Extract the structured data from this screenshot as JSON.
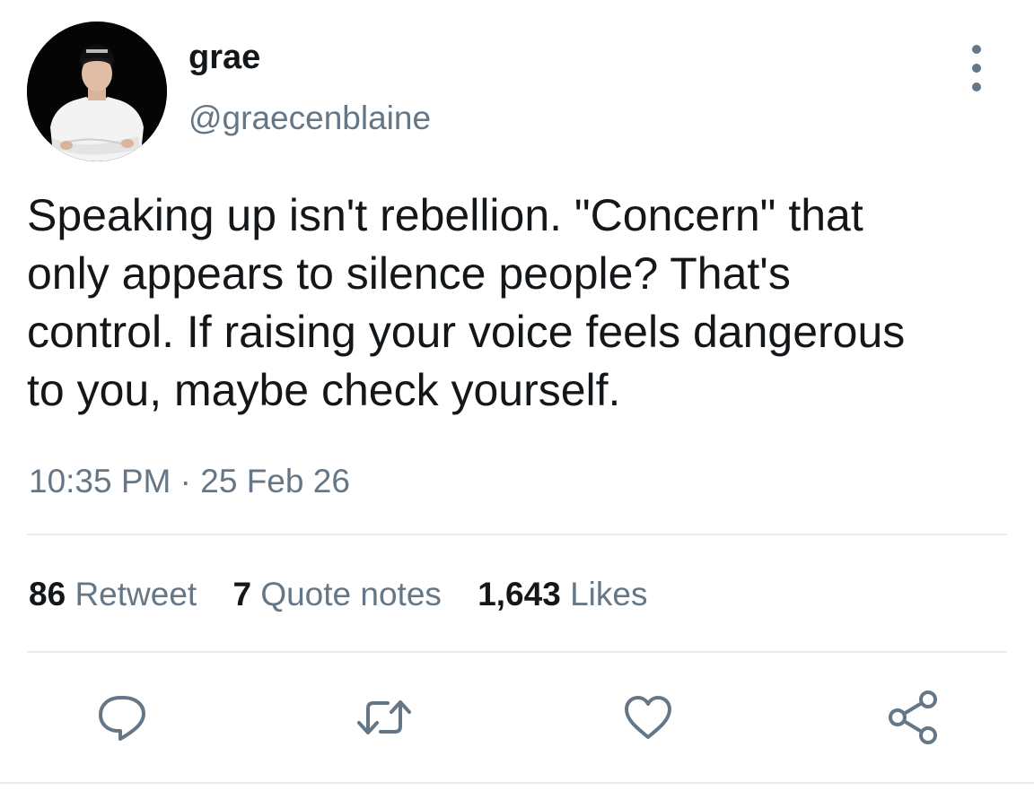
{
  "user": {
    "display_name": "grae",
    "handle": "@graecenblaine",
    "avatar_icon": "profile-photo"
  },
  "tweet": {
    "lines": [
      "Speaking up isn't rebellion. \"Concern\" that",
      "only appears to silence people? That's",
      "control. If raising your voice feels dangerous",
      "to you, maybe check yourself."
    ],
    "time": "10:35 PM",
    "separator": "·",
    "date": "25 Feb 26"
  },
  "stats": {
    "retweets": {
      "count": "86",
      "label": "Retweet"
    },
    "quotes": {
      "count": "7",
      "label": "Quote notes"
    },
    "likes": {
      "count": "1,643",
      "label": "Likes"
    }
  },
  "actions": {
    "icons": [
      "reply-icon",
      "retweet-icon",
      "like-icon",
      "share-icon"
    ]
  },
  "colors": {
    "primary_text": "#14171a",
    "secondary_text": "#657786",
    "divider": "#e6ecf0",
    "background": "#ffffff"
  }
}
